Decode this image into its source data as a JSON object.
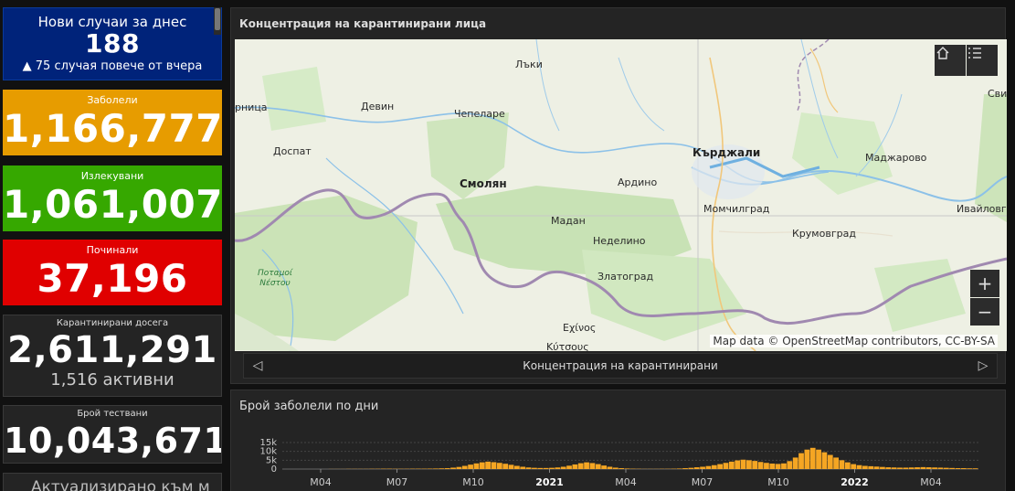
{
  "cards": {
    "new_cases": {
      "label": "Нови случаи за днес",
      "value": "188",
      "delta": "▲ 75 случая повече от вчера",
      "color": "#00237a"
    },
    "sick": {
      "label": "Заболели",
      "value": "1,166,777",
      "color": "#e79c00"
    },
    "recovered": {
      "label": "Излекувани",
      "value": "1,061,007",
      "color": "#36a800"
    },
    "deceased": {
      "label": "Починали",
      "value": "37,196",
      "color": "#e00000"
    },
    "quarantined": {
      "label": "Карантинирани досега",
      "value": "2,611,291",
      "active": "1,516 активни"
    },
    "tests": {
      "label": "Брой тествани",
      "value": "10,043,671"
    },
    "updated": {
      "label": "Актуализирано към м"
    }
  },
  "map_panel": {
    "title": "Концентрация на карантинирани лица",
    "attribution": "Map data © OpenStreetMap contributors, CC-BY-SA",
    "carousel_label": "Концентрация на карантинирани",
    "places": {
      "lyaki": "Лъки",
      "devin": "Девин",
      "chepelare": "Чепеларе",
      "dospat": "Доспат",
      "smolyan": "Смолян",
      "ardino": "Ардино",
      "kardzhali": "Кърджали",
      "madzharovo": "Маджарово",
      "momchilgrad": "Момчилград",
      "ivaylovgrad": "Ивайловгр",
      "madan": "Мадан",
      "nedelino": "Неделино",
      "krumovgrad": "Крумовград",
      "zlatograd": "Златоград",
      "potamoi": "Ποταμοί",
      "nestou": "Νέστου",
      "echinos": "Εχίνος",
      "koutsous": "Κύτσους",
      "left_edge": "рница",
      "right_edge": "Сви"
    },
    "icons": [
      "home-icon",
      "layer-list-icon",
      "zoom-in-icon",
      "zoom-out-icon",
      "chevron-left-icon",
      "chevron-right-icon"
    ]
  },
  "chart_panel": {
    "title": "Брой заболели по дни"
  },
  "chart_data": {
    "type": "bar",
    "title": "Брой заболели по дни",
    "yticks": [
      "15k",
      "10k",
      "5k",
      "0"
    ],
    "ytick_values": [
      15000,
      10000,
      5000,
      0
    ],
    "ylim": [
      0,
      15000
    ],
    "xticks": [
      "M04",
      "M07",
      "M10",
      "2021",
      "M04",
      "M07",
      "M10",
      "2022",
      "M04"
    ],
    "color": "#f5a623",
    "grid": true,
    "weekly_values": [
      0,
      0,
      0,
      0,
      0,
      0,
      0,
      0,
      50,
      50,
      50,
      100,
      100,
      100,
      100,
      150,
      150,
      200,
      200,
      150,
      150,
      150,
      200,
      200,
      200,
      250,
      300,
      400,
      500,
      800,
      1200,
      1800,
      2500,
      3200,
      3800,
      4200,
      3900,
      3500,
      3000,
      2400,
      1800,
      1300,
      900,
      700,
      600,
      600,
      700,
      900,
      1300,
      1900,
      2600,
      3300,
      3800,
      3400,
      2800,
      2000,
      1300,
      800,
      500,
      300,
      200,
      150,
      100,
      100,
      100,
      150,
      150,
      200,
      300,
      500,
      700,
      1000,
      1300,
      1700,
      2200,
      2800,
      3500,
      4200,
      4900,
      5300,
      5000,
      4600,
      4000,
      3500,
      3100,
      2900,
      3200,
      4500,
      6500,
      9000,
      11000,
      12000,
      11000,
      9500,
      8000,
      6500,
      5000,
      3800,
      2800,
      2200,
      1800,
      1600,
      1400,
      1200,
      1000,
      900,
      800,
      800,
      900,
      1000,
      1100,
      1000,
      900,
      800,
      700,
      600,
      500,
      500,
      400,
      400
    ]
  }
}
